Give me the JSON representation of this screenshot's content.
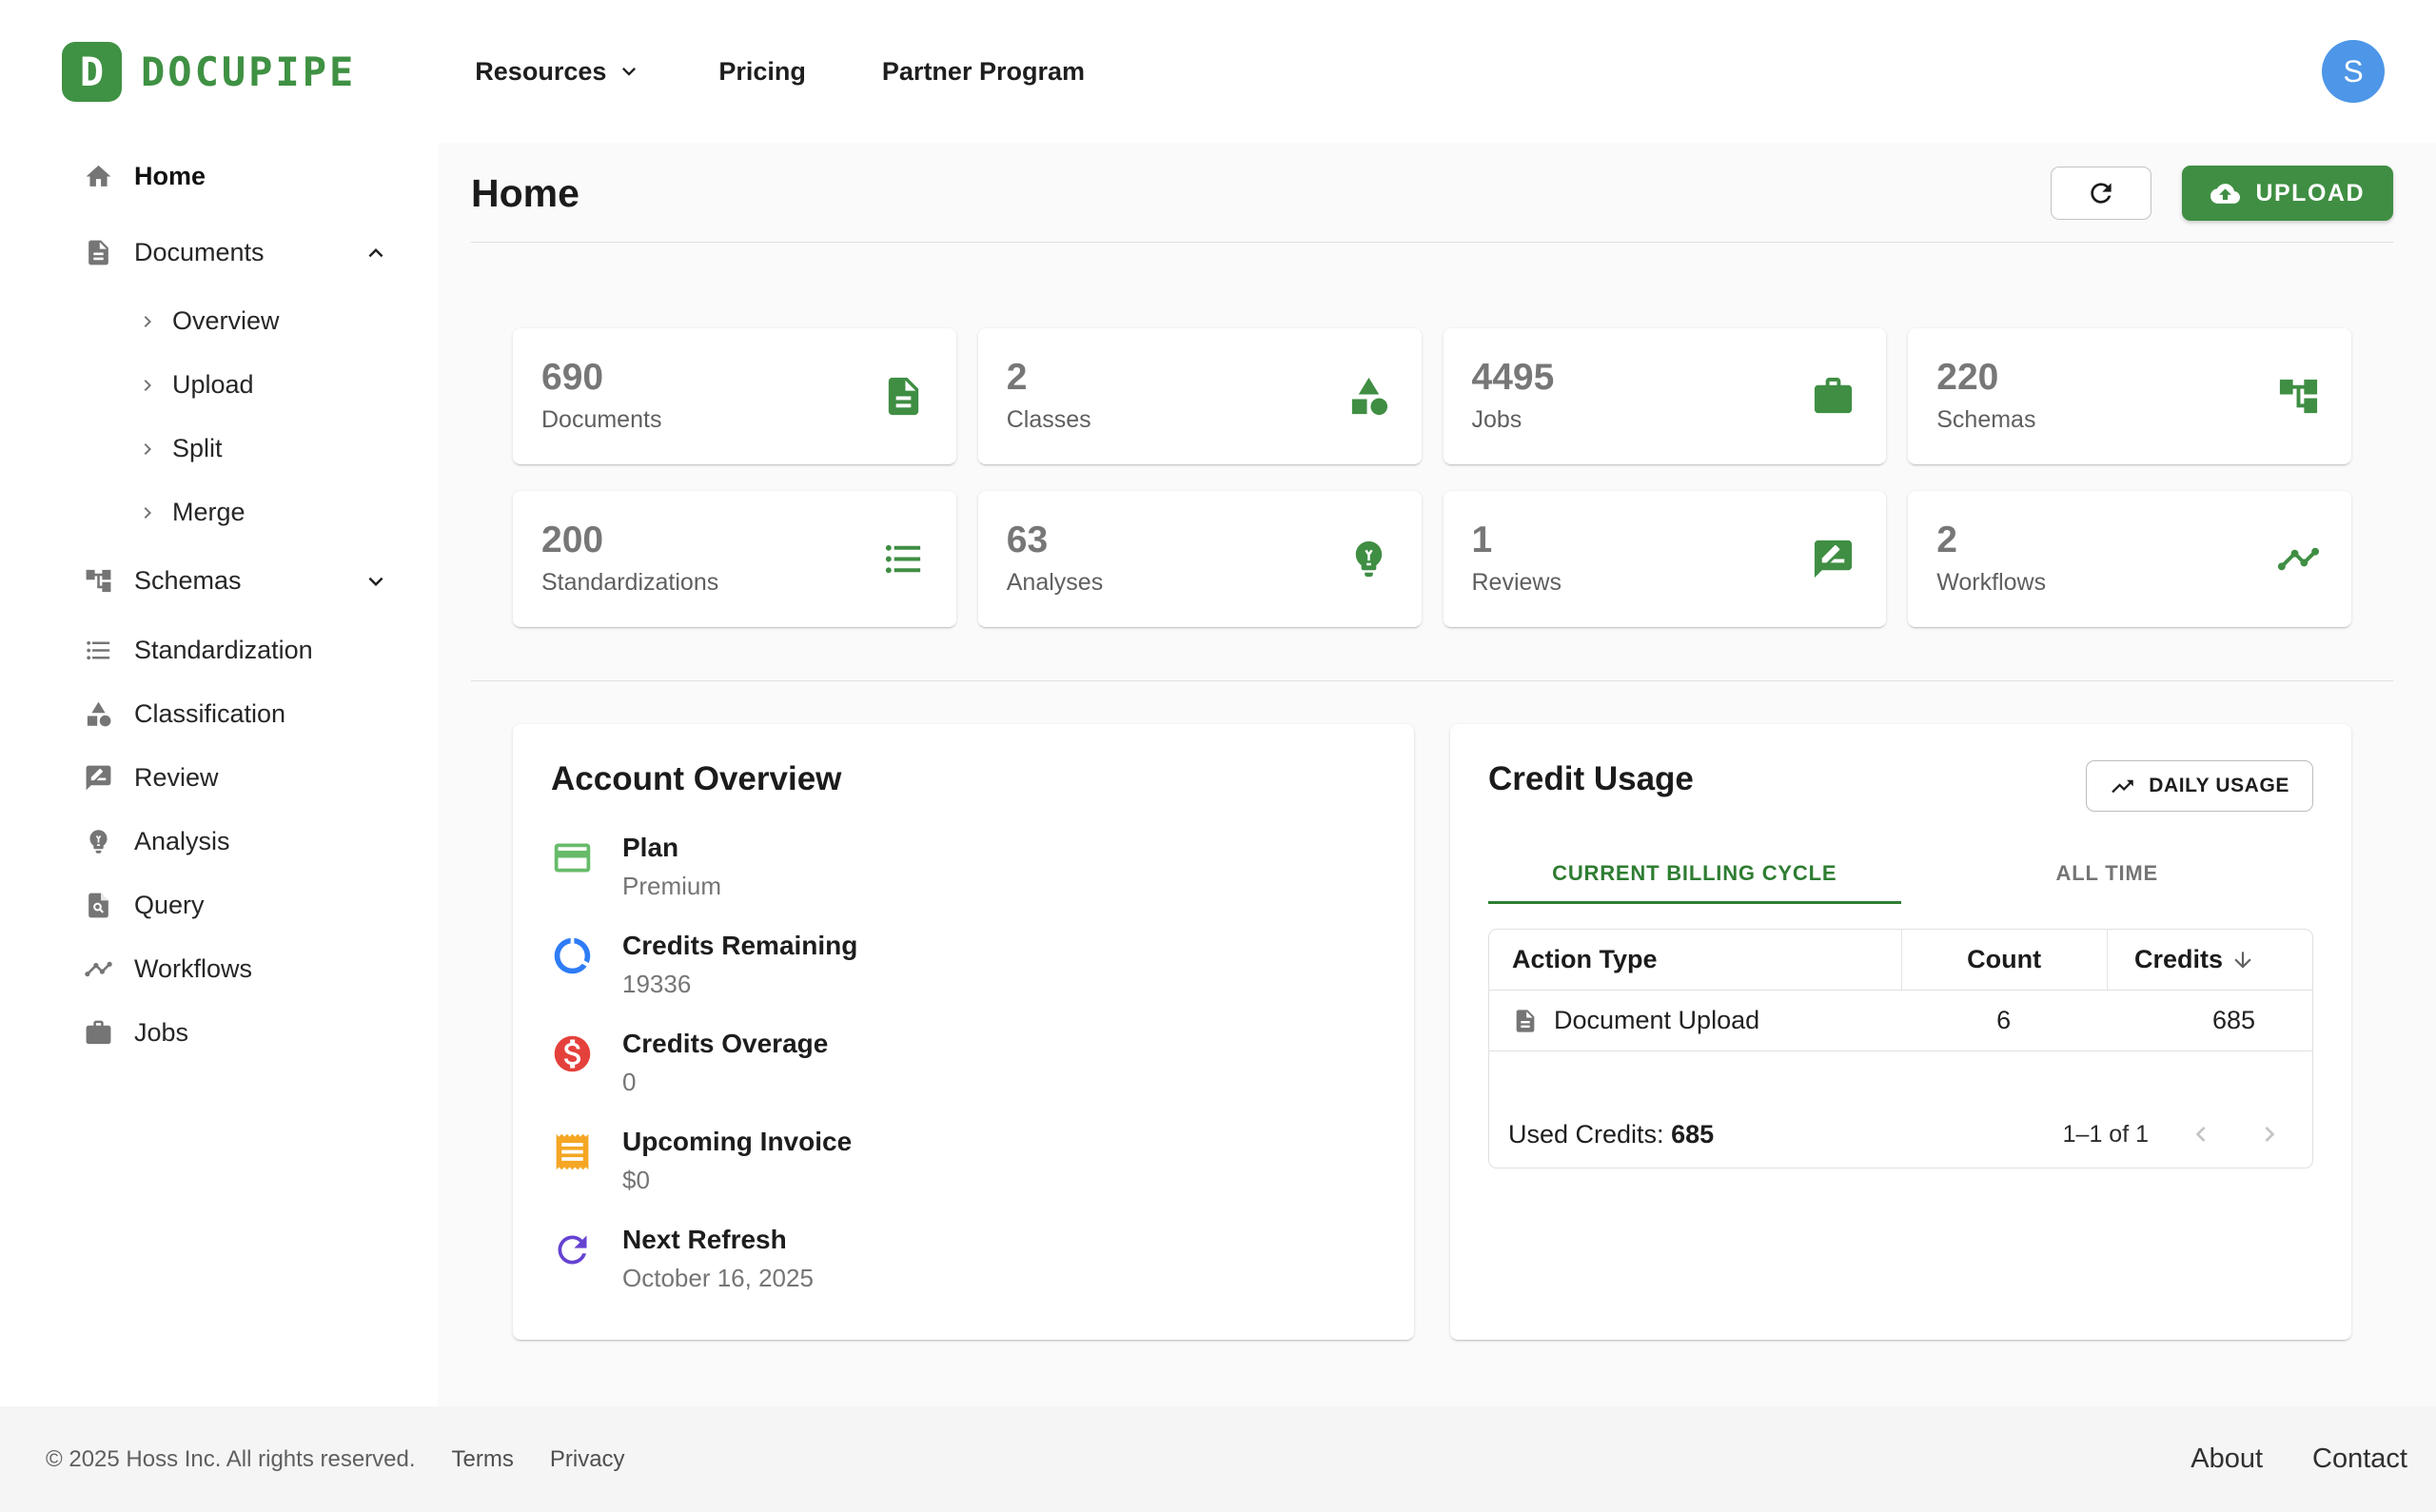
{
  "brand": {
    "name": "DOCUPIPE",
    "mark_letter": "D"
  },
  "colors": {
    "brand_green": "#3f9143",
    "upload_green": "#3f8e43",
    "active_tab_green": "#2e7d32",
    "avatar_blue": "#4d96e8",
    "plan_icon_green": "#66bb6a",
    "credits_icon_blue": "#2e7cf6",
    "overage_icon_red": "#e5413c",
    "invoice_icon_orange": "#f5a623",
    "refresh_icon_purple": "#6643d1"
  },
  "topnav": {
    "items": [
      {
        "label": "Resources",
        "has_dropdown": true
      },
      {
        "label": "Pricing",
        "has_dropdown": false
      },
      {
        "label": "Partner Program",
        "has_dropdown": false
      }
    ],
    "avatar_initial": "S"
  },
  "sidebar": {
    "items": [
      {
        "label": "Home",
        "icon": "home-icon",
        "active": true
      },
      {
        "label": "Documents",
        "icon": "document-icon",
        "expanded": true,
        "children": [
          {
            "label": "Overview"
          },
          {
            "label": "Upload"
          },
          {
            "label": "Split"
          },
          {
            "label": "Merge"
          }
        ]
      },
      {
        "label": "Schemas",
        "icon": "schema-tree-icon",
        "expanded": false
      },
      {
        "label": "Standardization",
        "icon": "list-icon"
      },
      {
        "label": "Classification",
        "icon": "category-icon"
      },
      {
        "label": "Review",
        "icon": "rate-review-icon"
      },
      {
        "label": "Analysis",
        "icon": "lightbulb-icon"
      },
      {
        "label": "Query",
        "icon": "document-search-icon"
      },
      {
        "label": "Workflows",
        "icon": "timeline-icon"
      },
      {
        "label": "Jobs",
        "icon": "briefcase-icon"
      }
    ]
  },
  "page": {
    "title": "Home",
    "upload_label": "UPLOAD"
  },
  "stats": [
    {
      "value": "690",
      "label": "Documents",
      "icon": "document-icon"
    },
    {
      "value": "2",
      "label": "Classes",
      "icon": "category-icon"
    },
    {
      "value": "4495",
      "label": "Jobs",
      "icon": "briefcase-icon"
    },
    {
      "value": "220",
      "label": "Schemas",
      "icon": "schema-tree-icon"
    },
    {
      "value": "200",
      "label": "Standardizations",
      "icon": "list-icon"
    },
    {
      "value": "63",
      "label": "Analyses",
      "icon": "lightbulb-icon"
    },
    {
      "value": "1",
      "label": "Reviews",
      "icon": "rate-review-icon"
    },
    {
      "value": "2",
      "label": "Workflows",
      "icon": "timeline-icon"
    }
  ],
  "account_overview": {
    "title": "Account Overview",
    "items": [
      {
        "label": "Plan",
        "value": "Premium",
        "icon": "credit-card-icon"
      },
      {
        "label": "Credits Remaining",
        "value": "19336",
        "icon": "donut-chart-icon"
      },
      {
        "label": "Credits Overage",
        "value": "0",
        "icon": "dollar-circle-icon"
      },
      {
        "label": "Upcoming Invoice",
        "value": "$0",
        "icon": "receipt-icon"
      },
      {
        "label": "Next Refresh",
        "value": "October 16, 2025",
        "icon": "refresh-icon"
      }
    ]
  },
  "credit_usage": {
    "title": "Credit Usage",
    "daily_usage_label": "DAILY USAGE",
    "tabs": [
      "CURRENT BILLING CYCLE",
      "ALL TIME"
    ],
    "active_tab": 0,
    "table": {
      "headers": [
        "Action Type",
        "Count",
        "Credits"
      ],
      "sort_column": "Credits",
      "rows": [
        {
          "action": "Document Upload",
          "count": "6",
          "credits": "685"
        }
      ]
    },
    "used_credits_label": "Used Credits:",
    "used_credits_value": "685",
    "pagination": "1–1 of 1"
  },
  "footer": {
    "copyright": "© 2025 Hoss Inc. All rights reserved.",
    "terms": "Terms",
    "privacy": "Privacy",
    "about": "About",
    "contact": "Contact"
  }
}
